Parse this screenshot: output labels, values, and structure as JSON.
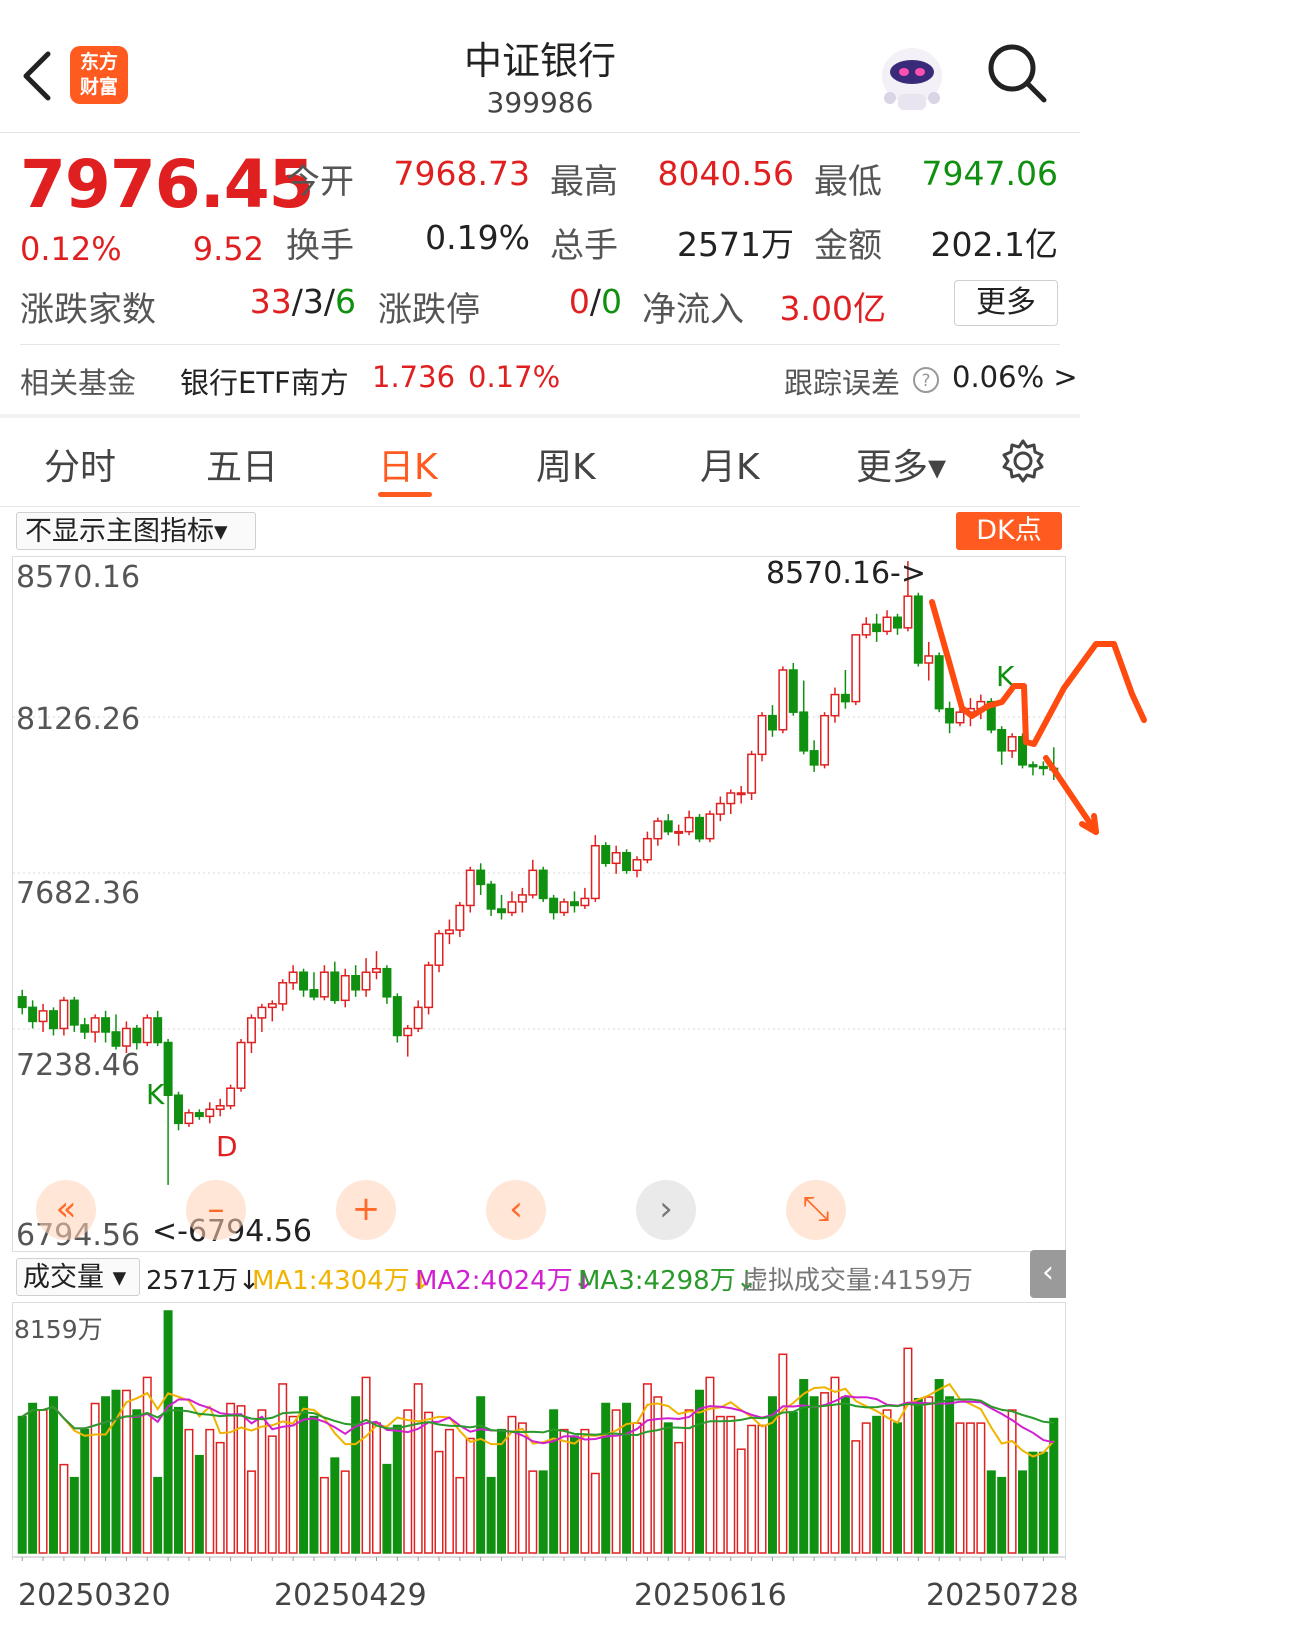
{
  "header": {
    "title": "中证银行",
    "code": "399986",
    "logo_line1": "东方",
    "logo_line2": "财富"
  },
  "quote": {
    "price": "7976.45",
    "change_pct": "0.12%",
    "change_abs": "9.52",
    "open_label": "今开",
    "open": "7968.73",
    "high_label": "最高",
    "high": "8040.56",
    "low_label": "最低",
    "low": "7947.06",
    "turnover_label": "换手",
    "turnover": "0.19%",
    "volume_label": "总手",
    "volume": "2571万",
    "amount_label": "金额",
    "amount": "202.1亿",
    "advdec_label": "涨跌家数",
    "adv": "33",
    "unch": "3",
    "dec": "6",
    "limit_label": "涨跌停",
    "limit_up": "0",
    "limit_down": "0",
    "netflow_label": "净流入",
    "netflow": "3.00亿",
    "more_label": "更多"
  },
  "fund": {
    "label": "相关基金",
    "name": "银行ETF南方",
    "price": "1.736",
    "pct": "0.17%",
    "tracking_label": "跟踪误差",
    "tracking_value": "0.06% >"
  },
  "tabs": [
    "分时",
    "五日",
    "日K",
    "周K",
    "月K",
    "更多▾"
  ],
  "active_tab": "日K",
  "indicator_select": "不显示主图指标▾",
  "dk_label": "DK点",
  "price_axis": [
    "8570.16",
    "8126.26",
    "7682.36",
    "7238.46",
    "6794.56"
  ],
  "annotations": {
    "high_marker": "8570.16->",
    "low_marker": "<-6794.56",
    "k1": "K",
    "d1": "D",
    "k2": "K"
  },
  "controls": [
    "«",
    "–",
    "+",
    "‹",
    "›",
    "⤡"
  ],
  "volume": {
    "select": "成交量 ▾",
    "current": "2571万↓",
    "ma1": "MA1:4304万↓",
    "ma2": "MA2:4024万↓",
    "ma3": "MA3:4298万↓",
    "virtual": "虚拟成交量:4159万",
    "axis_max": "8159万",
    "collapse": "‹"
  },
  "dates": [
    "20250320",
    "20250429",
    "20250616",
    "20250728"
  ],
  "colors": {
    "up": "#e02020",
    "down": "#109010",
    "accent": "#ff5a1f",
    "ma1": "#f0b400",
    "ma2": "#d020d0",
    "ma3": "#2a9a2a",
    "annotation": "#ff4a10"
  },
  "chart_data": {
    "type": "candlestick",
    "ylim": [
      6794.56,
      8570.16
    ],
    "ohlc": [
      [
        7330,
        7350,
        7280,
        7300
      ],
      [
        7300,
        7320,
        7240,
        7260
      ],
      [
        7260,
        7310,
        7230,
        7290
      ],
      [
        7290,
        7300,
        7220,
        7240
      ],
      [
        7240,
        7330,
        7220,
        7320
      ],
      [
        7320,
        7330,
        7230,
        7250
      ],
      [
        7250,
        7270,
        7210,
        7230
      ],
      [
        7230,
        7280,
        7200,
        7270
      ],
      [
        7270,
        7290,
        7200,
        7230
      ],
      [
        7230,
        7280,
        7180,
        7190
      ],
      [
        7190,
        7260,
        7170,
        7240
      ],
      [
        7240,
        7250,
        7180,
        7200
      ],
      [
        7200,
        7280,
        7190,
        7270
      ],
      [
        7270,
        7290,
        7190,
        7200
      ],
      [
        7200,
        7210,
        6795,
        7050
      ],
      [
        7050,
        7060,
        6950,
        6970
      ],
      [
        6970,
        7010,
        6960,
        7000
      ],
      [
        7000,
        7010,
        6980,
        6990
      ],
      [
        6990,
        7030,
        6970,
        7010
      ],
      [
        7010,
        7040,
        6990,
        7020
      ],
      [
        7020,
        7080,
        7010,
        7070
      ],
      [
        7070,
        7210,
        7060,
        7200
      ],
      [
        7200,
        7280,
        7170,
        7270
      ],
      [
        7270,
        7310,
        7230,
        7300
      ],
      [
        7300,
        7320,
        7260,
        7310
      ],
      [
        7310,
        7380,
        7290,
        7370
      ],
      [
        7370,
        7420,
        7350,
        7400
      ],
      [
        7400,
        7410,
        7330,
        7350
      ],
      [
        7350,
        7400,
        7320,
        7330
      ],
      [
        7330,
        7420,
        7320,
        7400
      ],
      [
        7400,
        7430,
        7310,
        7320
      ],
      [
        7320,
        7410,
        7300,
        7390
      ],
      [
        7390,
        7420,
        7330,
        7350
      ],
      [
        7350,
        7440,
        7330,
        7400
      ],
      [
        7400,
        7460,
        7380,
        7410
      ],
      [
        7410,
        7420,
        7310,
        7330
      ],
      [
        7330,
        7340,
        7200,
        7220
      ],
      [
        7220,
        7250,
        7160,
        7240
      ],
      [
        7240,
        7320,
        7230,
        7300
      ],
      [
        7300,
        7430,
        7280,
        7420
      ],
      [
        7420,
        7520,
        7400,
        7510
      ],
      [
        7510,
        7550,
        7480,
        7520
      ],
      [
        7520,
        7600,
        7500,
        7590
      ],
      [
        7590,
        7700,
        7570,
        7690
      ],
      [
        7690,
        7710,
        7620,
        7650
      ],
      [
        7650,
        7660,
        7560,
        7580
      ],
      [
        7580,
        7620,
        7550,
        7570
      ],
      [
        7570,
        7630,
        7560,
        7600
      ],
      [
        7600,
        7640,
        7570,
        7620
      ],
      [
        7620,
        7720,
        7610,
        7690
      ],
      [
        7690,
        7700,
        7600,
        7610
      ],
      [
        7610,
        7620,
        7550,
        7570
      ],
      [
        7570,
        7610,
        7560,
        7600
      ],
      [
        7600,
        7630,
        7570,
        7590
      ],
      [
        7590,
        7640,
        7580,
        7610
      ],
      [
        7610,
        7790,
        7600,
        7760
      ],
      [
        7760,
        7770,
        7700,
        7710
      ],
      [
        7710,
        7760,
        7680,
        7740
      ],
      [
        7740,
        7750,
        7680,
        7690
      ],
      [
        7690,
        7730,
        7670,
        7720
      ],
      [
        7720,
        7800,
        7710,
        7780
      ],
      [
        7780,
        7840,
        7760,
        7830
      ],
      [
        7830,
        7850,
        7790,
        7800
      ],
      [
        7800,
        7820,
        7760,
        7800
      ],
      [
        7800,
        7860,
        7790,
        7840
      ],
      [
        7840,
        7850,
        7770,
        7780
      ],
      [
        7780,
        7860,
        7770,
        7850
      ],
      [
        7850,
        7900,
        7830,
        7880
      ],
      [
        7880,
        7920,
        7850,
        7910
      ],
      [
        7910,
        7930,
        7880,
        7910
      ],
      [
        7910,
        8030,
        7890,
        8020
      ],
      [
        8020,
        8140,
        8000,
        8130
      ],
      [
        8130,
        8160,
        8070,
        8090
      ],
      [
        8090,
        8270,
        8080,
        8260
      ],
      [
        8260,
        8280,
        8130,
        8140
      ],
      [
        8140,
        8230,
        8020,
        8030
      ],
      [
        8030,
        8060,
        7970,
        7990
      ],
      [
        7990,
        8140,
        7980,
        8130
      ],
      [
        8130,
        8210,
        8110,
        8190
      ],
      [
        8190,
        8260,
        8150,
        8170
      ],
      [
        8170,
        8360,
        8160,
        8360
      ],
      [
        8360,
        8410,
        8350,
        8390
      ],
      [
        8390,
        8420,
        8340,
        8370
      ],
      [
        8370,
        8430,
        8360,
        8410
      ],
      [
        8410,
        8420,
        8360,
        8380
      ],
      [
        8380,
        8570,
        8370,
        8470
      ],
      [
        8470,
        8480,
        8270,
        8280
      ],
      [
        8280,
        8340,
        8230,
        8300
      ],
      [
        8300,
        8310,
        8140,
        8150
      ],
      [
        8150,
        8170,
        8080,
        8110
      ],
      [
        8110,
        8160,
        8100,
        8140
      ],
      [
        8140,
        8180,
        8100,
        8150
      ],
      [
        8150,
        8190,
        8120,
        8170
      ],
      [
        8170,
        8180,
        8080,
        8090
      ],
      [
        8090,
        8100,
        7990,
        8030
      ],
      [
        8030,
        8080,
        8010,
        8070
      ],
      [
        8070,
        8080,
        7980,
        7990
      ],
      [
        7990,
        8000,
        7960,
        7985
      ],
      [
        7985,
        8000,
        7960,
        7980
      ],
      [
        7980,
        8040,
        7947,
        7976
      ]
    ],
    "volume_max": 8159,
    "volume_unit": "万"
  }
}
